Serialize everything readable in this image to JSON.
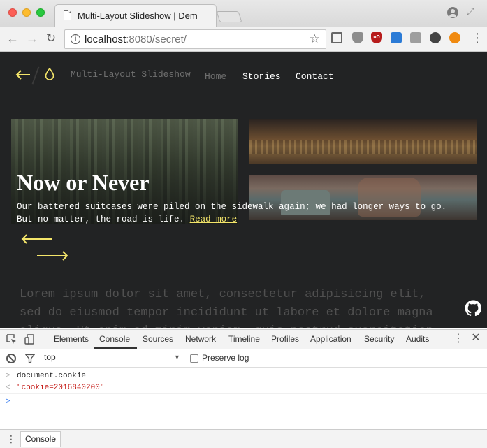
{
  "browser": {
    "tab_title": "Multi-Layout Slideshow | Dem",
    "url_host": "localhost",
    "url_rest": ":8080/secret/",
    "icons": [
      "tab-favicon-icon",
      "profile-icon",
      "fullscreen-icon",
      "back-icon",
      "forward-icon",
      "reload-icon",
      "info-icon",
      "star-icon",
      "cast-icon",
      "shield-icon",
      "ublock-icon",
      "extension-icon",
      "menu-icon"
    ],
    "ublock_label": "uD"
  },
  "page": {
    "site_title": "Multi-Layout Slideshow",
    "nav": {
      "home": "Home",
      "stories": "Stories",
      "contact": "Contact"
    },
    "slide": {
      "title": "Now or Never",
      "description": "Our battered suitcases were piled on the sidewalk again; we had longer ways to go. But no matter, the road is life.",
      "read_more": "Read more"
    },
    "lorem": "Lorem ipsum dolor sit amet, consectetur adipisicing elit, sed do eiusmod tempor incididunt ut labore et dolore magna aliqua. Ut enim ad minim veniam, quis nostrud exercitation",
    "accent_color": "#f4e56a"
  },
  "devtools": {
    "tabs": {
      "elements": "Elements",
      "console": "Console",
      "sources": "Sources",
      "network": "Network",
      "timeline": "Timeline",
      "profiles": "Profiles",
      "application": "Application",
      "security": "Security",
      "audits": "Audits"
    },
    "context": "top",
    "preserve_log": "Preserve log",
    "console_lines": {
      "input": "document.cookie",
      "output": "\"cookie=2016840200\""
    },
    "prompt_symbols": {
      "input": ">",
      "output": "<",
      "active": ">"
    },
    "drawer_tab": "Console"
  }
}
